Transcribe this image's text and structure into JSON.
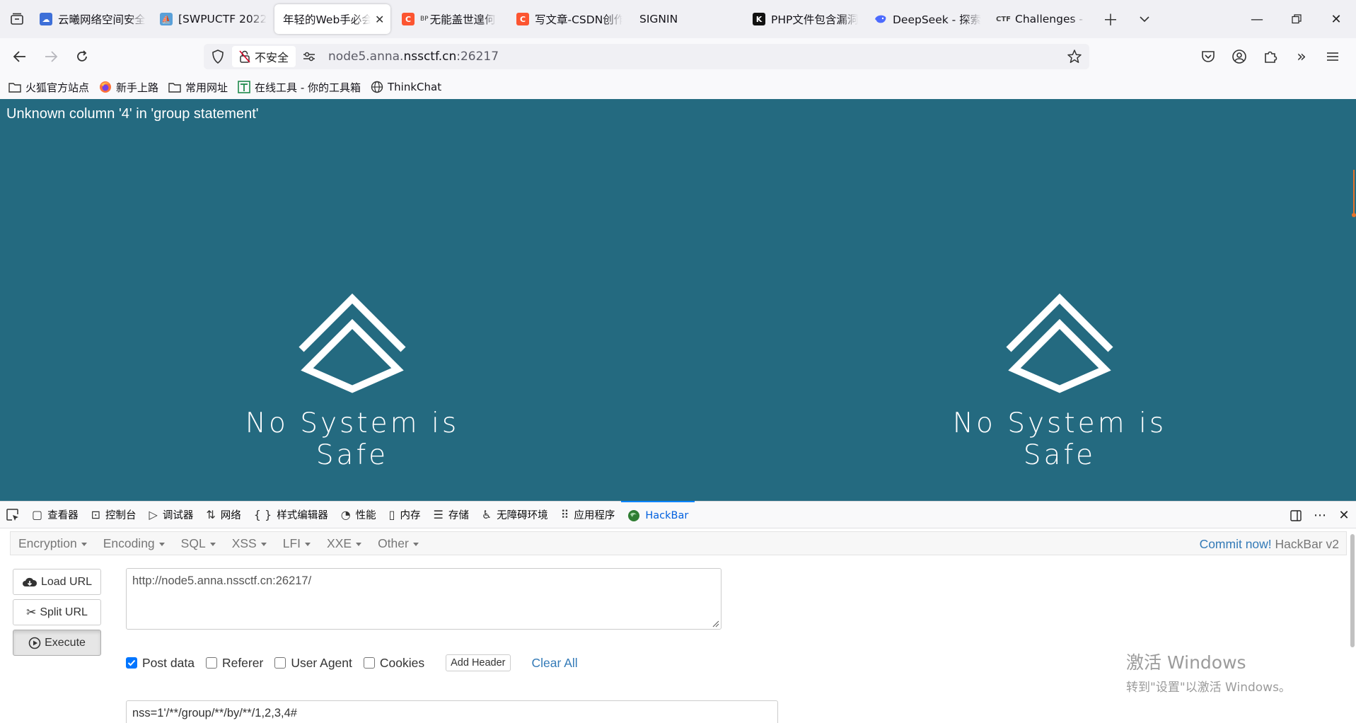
{
  "tabs": [
    {
      "title": "云曦网络空间安全",
      "favicon": "cloud-icon",
      "color": "#3d6fd8"
    },
    {
      "title": "[SWPUCTF 2022",
      "favicon": "ship-icon",
      "color": "#5aa0d8"
    },
    {
      "title": "年轻的Web手必会",
      "favicon": "",
      "color": "",
      "active": true
    },
    {
      "title": "无能盖世遑何",
      "favicon": "csdn-icon",
      "color": "#fc5531",
      "prefix": "BP"
    },
    {
      "title": "写文章-CSDN创作",
      "favicon": "csdn-icon",
      "color": "#fc5531"
    },
    {
      "title": "SIGNIN",
      "favicon": "",
      "color": ""
    },
    {
      "title": "PHP文件包含漏洞",
      "favicon": "k-icon",
      "color": "#111111"
    },
    {
      "title": "DeepSeek - 探索",
      "favicon": "deepseek-icon",
      "color": "#4d6bfe"
    },
    {
      "title": "Challenges - CTF",
      "favicon": "ctf-icon",
      "color": "#444444",
      "prefix": "CTF"
    }
  ],
  "navbar": {
    "insecure_label": "不安全",
    "url_prefix": "node5.anna.",
    "url_domain": "nssctf.cn",
    "url_suffix": ":26217"
  },
  "bookmarks": [
    {
      "label": "火狐官方站点",
      "icon": "folder-icon"
    },
    {
      "label": "新手上路",
      "icon": "firefox-icon"
    },
    {
      "label": "常用网址",
      "icon": "folder-icon"
    },
    {
      "label": "在线工具 - 你的工具箱",
      "icon": "tool-icon"
    },
    {
      "label": "ThinkChat",
      "icon": "globe-icon"
    }
  ],
  "page": {
    "error_message": "Unknown column '4' in 'group statement'",
    "tagline": "No System is Safe",
    "background": "#246a80"
  },
  "devtools": {
    "tabs": [
      {
        "label": "查看器",
        "icon": "inspector-icon"
      },
      {
        "label": "控制台",
        "icon": "console-icon"
      },
      {
        "label": "调试器",
        "icon": "debugger-icon"
      },
      {
        "label": "网络",
        "icon": "network-icon"
      },
      {
        "label": "样式编辑器",
        "icon": "style-editor-icon"
      },
      {
        "label": "性能",
        "icon": "performance-icon"
      },
      {
        "label": "内存",
        "icon": "memory-icon"
      },
      {
        "label": "存储",
        "icon": "storage-icon"
      },
      {
        "label": "无障碍环境",
        "icon": "accessibility-icon"
      },
      {
        "label": "应用程序",
        "icon": "application-icon"
      },
      {
        "label": "HackBar",
        "icon": "hackbar-icon",
        "active": true
      }
    ]
  },
  "hackbar": {
    "menus": [
      "Encryption",
      "Encoding",
      "SQL",
      "XSS",
      "LFI",
      "XXE",
      "Other"
    ],
    "commit_link": "Commit now!",
    "version": "HackBar v2",
    "load_url": "Load URL",
    "split_url": "Split URL",
    "execute": "Execute",
    "url_value": "http://node5.anna.nssctf.cn:26217/",
    "options": {
      "post_data": "Post data",
      "referer": "Referer",
      "user_agent": "User Agent",
      "cookies": "Cookies"
    },
    "add_header": "Add Header",
    "clear_all": "Clear All",
    "post_value": "nss=1'/**/group/**/by/**/1,2,3,4#"
  },
  "watermark": {
    "line1": "激活 Windows",
    "line2": "转到\"设置\"以激活 Windows。"
  }
}
